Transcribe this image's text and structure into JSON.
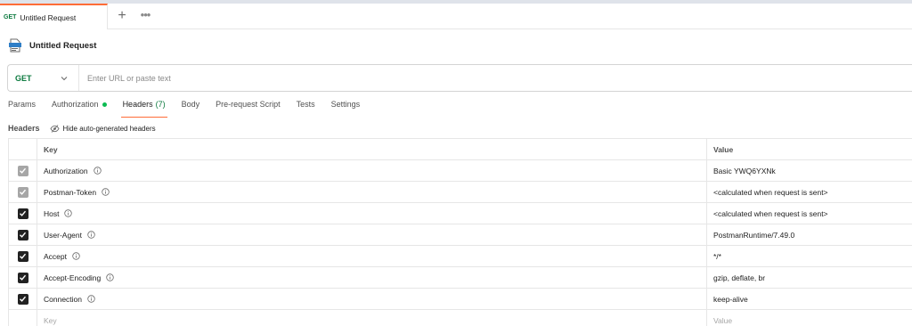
{
  "tab": {
    "method": "GET",
    "title": "Untitled Request",
    "add_symbol": "+",
    "more_symbol": "•••"
  },
  "request": {
    "name": "Untitled Request",
    "method": "GET",
    "url_value": "",
    "url_placeholder": "Enter URL or paste text"
  },
  "subtabs": [
    {
      "label": "Params"
    },
    {
      "label": "Authorization",
      "indicator": "green-dot"
    },
    {
      "label": "Headers",
      "count": "(7)",
      "active": true
    },
    {
      "label": "Body"
    },
    {
      "label": "Pre-request Script"
    },
    {
      "label": "Tests"
    },
    {
      "label": "Settings"
    }
  ],
  "headers_section": {
    "label": "Headers",
    "hide_auto_label": "Hide auto-generated headers"
  },
  "table": {
    "columns": {
      "key": "Key",
      "value": "Value"
    },
    "rows": [
      {
        "key": "Authorization",
        "value": "Basic YWQ6YXNk",
        "checked": true,
        "disabled": true
      },
      {
        "key": "Postman-Token",
        "value": "<calculated when request is sent>",
        "checked": true,
        "disabled": true
      },
      {
        "key": "Host",
        "value": "<calculated when request is sent>",
        "checked": true,
        "disabled": false
      },
      {
        "key": "User-Agent",
        "value": "PostmanRuntime/7.49.0",
        "checked": true,
        "disabled": false
      },
      {
        "key": "Accept",
        "value": "*/*",
        "checked": true,
        "disabled": false
      },
      {
        "key": "Accept-Encoding",
        "value": "gzip, deflate, br",
        "checked": true,
        "disabled": false
      },
      {
        "key": "Connection",
        "value": "keep-alive",
        "checked": true,
        "disabled": false
      }
    ],
    "new_row": {
      "key_placeholder": "Key",
      "value_placeholder": "Value"
    }
  },
  "colors": {
    "accent": "#ff6c37",
    "method_get": "#0c7a3f",
    "auth_dot": "#0cbb52"
  }
}
